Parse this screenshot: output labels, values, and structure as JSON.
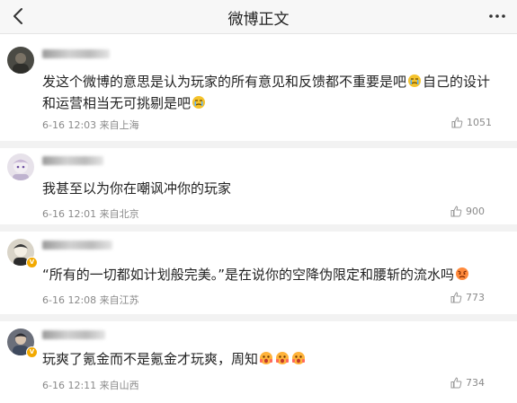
{
  "header": {
    "title": "微博正文"
  },
  "comments": [
    {
      "lines": [
        "发这个微博的意思是认为玩家的所有意见和反馈都不重要是吧",
        "自己的设计",
        "和运营相当无可挑剔是吧"
      ],
      "time": "6-16 12:03 来自上海",
      "likes": "1051"
    },
    {
      "text": "我甚至以为你在嘲讽冲你的玩家",
      "time": "6-16 12:01 来自北京",
      "likes": "900"
    },
    {
      "text": "“所有的一切都如计划般完美。”是在说你的空降伪限定和腰斩的流水吗",
      "time": "6-16 12:08 来自江苏",
      "likes": "773"
    },
    {
      "text": "玩爽了氪金而不是氪金才玩爽，周知",
      "time": "6-16 12:11 来自山西",
      "likes": "734"
    }
  ],
  "icons": {
    "back": "chevron-left-icon",
    "more": "more-dots-icon",
    "like": "thumbs-up-icon",
    "verified": "verified-badge-icon",
    "emoji_sad": "crying-emoji-icon",
    "emoji_shock": "shocked-emoji-icon",
    "emoji_angry": "angry-emoji-icon"
  },
  "colors": {
    "meta_gray": "#8a8a8a",
    "badge_gold": "#f2a900",
    "separator": "#f2f2f2"
  }
}
